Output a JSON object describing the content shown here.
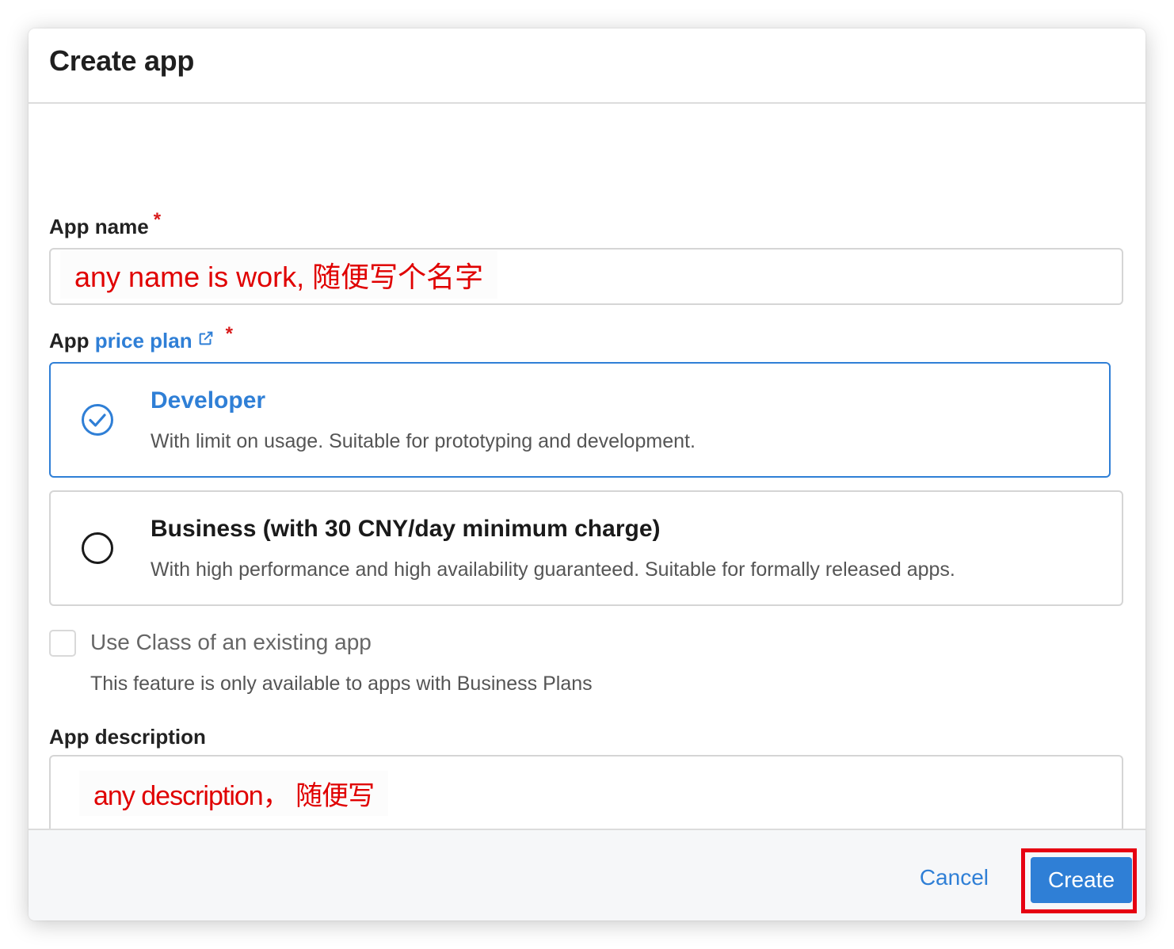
{
  "dialog": {
    "title": "Create app"
  },
  "form": {
    "app_name_label": "App name",
    "required_mark": "*",
    "app_name_value": "any name is work, 随便写个名字",
    "price_plan_prefix": "App",
    "price_plan_link": "price plan",
    "plans": [
      {
        "title": "Developer",
        "description": "With limit on usage. Suitable for prototyping and development.",
        "selected": true
      },
      {
        "title": "Business (with 30 CNY/day minimum charge)",
        "description": "With high performance and high availability guaranteed. Suitable for formally released apps.",
        "selected": false
      }
    ],
    "use_class_label": "Use Class of an existing app",
    "use_class_hint": "This feature is only available to apps with Business Plans",
    "description_label": "App description",
    "description_value": "any description， 随便写"
  },
  "footer": {
    "cancel_label": "Cancel",
    "create_label": "Create"
  },
  "colors": {
    "accent": "#2f7fd6",
    "required": "#d81b1b",
    "annotation": "#e00000",
    "highlight_box": "#e60012"
  },
  "icons": {
    "external_link": "external-link-icon",
    "radio_checked": "check-circle-icon",
    "radio_unchecked": "radio-unchecked-icon",
    "resize_handle": "resize-handle-icon"
  }
}
